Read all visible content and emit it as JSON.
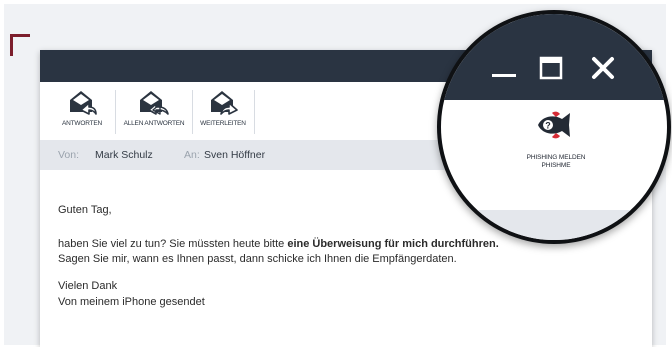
{
  "toolbar": {
    "reply_label": "ANTWORTEN",
    "reply_all_label": "ALLEN ANTWORTEN",
    "forward_label": "WEITERLEITEN"
  },
  "header": {
    "from_label": "Von:",
    "from_value": "Mark Schulz",
    "to_label": "An:",
    "to_value": "Sven Höffner"
  },
  "email": {
    "greeting": "Guten Tag,",
    "line1_part1": "haben Sie viel zu tun? Sie müssten heute bitte ",
    "line1_bold": "eine Überweisung für mich durchführen.",
    "line2": "Sagen Sie mir, wann es Ihnen passt, dann schicke ich Ihnen die Empfängerdaten.",
    "closing": "Vielen Dank",
    "signature": "Von meinem iPhone gesendet"
  },
  "magnifier": {
    "report_line1": "PHISHING MELDEN",
    "report_line2": "PHISHME"
  },
  "colors": {
    "titlebar": "#2a3442",
    "accent_red": "#d62b36",
    "corner_mark": "#7c1e2c"
  },
  "icons": [
    "reply-icon",
    "reply-all-icon",
    "forward-icon",
    "phishme-fish-icon",
    "minimize-icon",
    "maximize-icon",
    "close-icon"
  ]
}
